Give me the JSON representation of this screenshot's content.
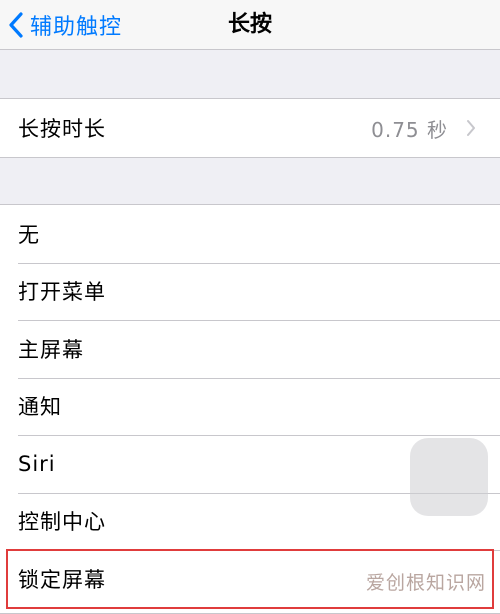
{
  "nav": {
    "back_label": "辅助触控",
    "title": "长按"
  },
  "duration_row": {
    "label": "长按时长",
    "value": "0.75 秒"
  },
  "action_options": [
    {
      "label": "无"
    },
    {
      "label": "打开菜单"
    },
    {
      "label": "主屏幕"
    },
    {
      "label": "通知"
    },
    {
      "label": "Siri"
    },
    {
      "label": "控制中心"
    },
    {
      "label": "锁定屏幕"
    }
  ],
  "watermark": "爱创根知识网",
  "colors": {
    "accent": "#007aff",
    "highlight": "#e03c3c",
    "secondary_text": "#8e8e93",
    "background": "#efeff4"
  },
  "icons": {
    "back": "chevron-left-icon",
    "disclosure": "chevron-right-icon"
  }
}
